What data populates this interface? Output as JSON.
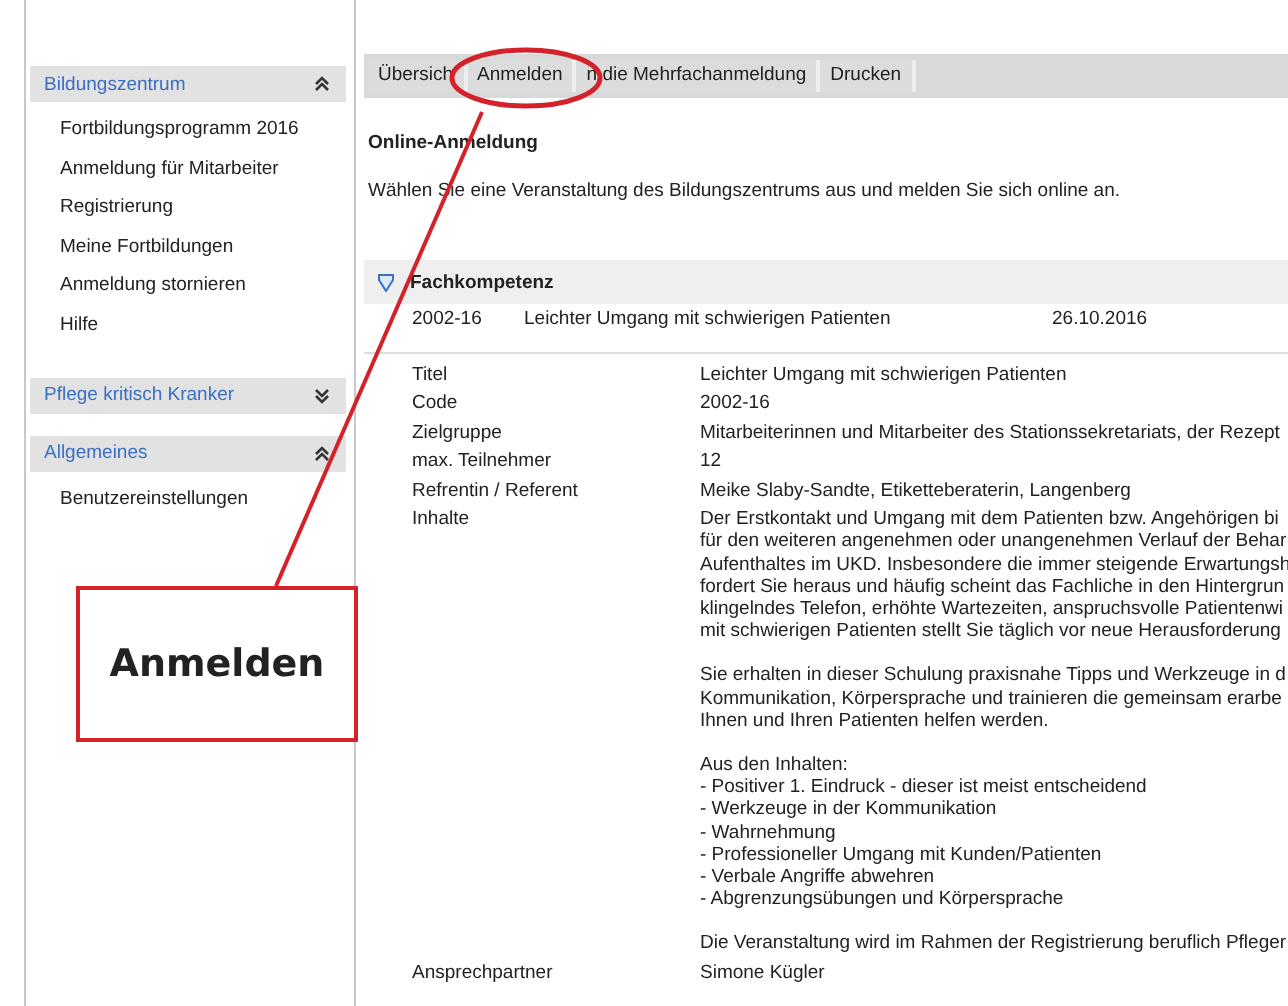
{
  "sidebar": {
    "groups": [
      {
        "title": "Bildungszentrum",
        "expanded": true,
        "items": [
          "Fortbildungsprogramm 2016",
          "Anmeldung für Mitarbeiter",
          "Registrierung",
          "Meine Fortbildungen",
          "Anmeldung stornieren",
          "Hilfe"
        ]
      },
      {
        "title": "Pflege kritisch Kranker",
        "expanded": false
      },
      {
        "title": "Allgemeines",
        "expanded": true,
        "items": [
          "Benutzereinstellungen"
        ]
      }
    ]
  },
  "tabs": [
    "Übersich",
    "Anmelden",
    "n die Mehrfachanmeldung",
    "Drucken"
  ],
  "page": {
    "title": "Online-Anmeldung",
    "intro": "Wählen Sie eine Veranstaltung des Bildungszentrums aus und melden Sie sich online an."
  },
  "section": {
    "title": "Fachkompetenz",
    "expanded": true,
    "course": {
      "code": "2002-16",
      "title": "Leichter Umgang mit schwierigen Patienten",
      "date": "26.10.2016"
    }
  },
  "details": [
    {
      "label": "Titel",
      "lines": [
        [
          "Leichter Umgang mit schwierigen Patienten"
        ]
      ]
    },
    {
      "label": "Code",
      "lines": [
        [
          "2002-16"
        ]
      ]
    },
    {
      "label": "Zielgruppe",
      "lines": [
        [
          "Mitarbeiterinnen und Mitarbeiter des Stationssekretariats, der Rezept"
        ]
      ]
    },
    {
      "label": "max. Teilnehmer",
      "lines": [
        [
          "12"
        ]
      ]
    },
    {
      "label": "Refrentin / Referent",
      "lines": [
        [
          "Meike Slaby-Sandte, Etiketteberaterin, Langenberg"
        ]
      ]
    },
    {
      "label": "Inhalte",
      "lines": [
        [
          "Der Erstkontakt und Umgang mit dem Patienten bzw. Angehörigen bi",
          "für den weiteren angenehmen oder unangenehmen Verlauf der Behar",
          "Aufenthaltes im UKD. Insbesondere die immer steigende Erwartungsh",
          "fordert Sie heraus und häufig scheint das Fachliche in den Hintergrun",
          "klingelndes Telefon, erhöhte Wartezeiten, anspruchsvolle Patientenwi",
          "mit schwierigen Patienten stellt Sie täglich vor neue Herausforderung"
        ],
        [
          "Sie erhalten in dieser Schulung praxisnahe Tipps und Werkzeuge in d",
          "Kommunikation, Körpersprache und trainieren die gemeinsam erarbe",
          "Ihnen und Ihren Patienten helfen werden."
        ],
        [
          "Aus den Inhalten:",
          "- Positiver 1. Eindruck - dieser ist meist entscheidend",
          "- Werkzeuge in der Kommunikation",
          "- Wahrnehmung",
          "- Professioneller Umgang mit Kunden/Patienten",
          "- Verbale Angriffe abwehren",
          "- Abgrenzungsübungen und Körpersprache"
        ],
        [
          "Die Veranstaltung wird im Rahmen der Registrierung beruflich Pfleger"
        ]
      ]
    },
    {
      "label": "Ansprechpartner",
      "lines": [
        [
          "Simone Kügler"
        ]
      ]
    }
  ],
  "annotation": {
    "label": "Anmelden"
  }
}
